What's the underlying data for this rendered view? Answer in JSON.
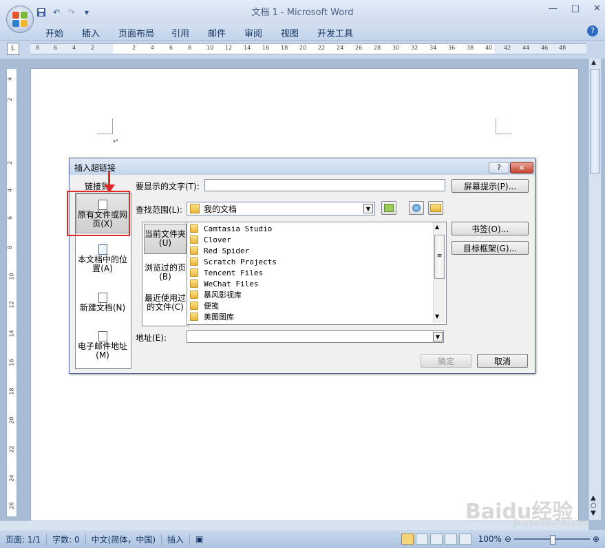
{
  "window": {
    "title": "文档 1 - Microsoft Word"
  },
  "qat": {
    "save": "save-icon",
    "undo": "↶",
    "redo": "↷",
    "more": "▾"
  },
  "tabs": [
    "开始",
    "插入",
    "页面布局",
    "引用",
    "邮件",
    "审阅",
    "视图",
    "开发工具"
  ],
  "help": "?",
  "ruler": {
    "tab_selector": "L",
    "h_numbers": [
      "8",
      "6",
      "4",
      "2",
      "2",
      "4",
      "6",
      "8",
      "10",
      "12",
      "14",
      "16",
      "18",
      "20",
      "22",
      "24",
      "26",
      "28",
      "30",
      "32",
      "34",
      "36",
      "38",
      "40",
      "42",
      "44",
      "46",
      "48"
    ],
    "v_numbers": [
      "4",
      "2",
      "2",
      "4",
      "6",
      "8",
      "10",
      "12",
      "14",
      "16",
      "18",
      "20",
      "22",
      "24",
      "26"
    ]
  },
  "dialog": {
    "title": "插入超链接",
    "help_button": "?",
    "close_button": "×",
    "link_to_label": "链接到:",
    "display_text_label": "要显示的文字(T):",
    "display_text_value": "",
    "screentip_button": "屏幕提示(P)...",
    "lookin_label": "查找范围(L):",
    "lookin_value": "我的文档",
    "link_items": [
      "原有文件或网页(X)",
      "本文档中的位置(A)",
      "新建文档(N)",
      "电子邮件地址(M)"
    ],
    "side_tabs": [
      "当前文件夹(U)",
      "浏览过的页(B)",
      "最近使用过的文件(C)"
    ],
    "files": [
      "Camtasia Studio",
      "Clover",
      "Red Spider",
      "Scratch Projects",
      "Tencent Files",
      "WeChat Files",
      "暴风影视库",
      "便笺",
      "美图图库"
    ],
    "bookmark_button": "书签(O)...",
    "target_frame_button": "目标框架(G)...",
    "address_label": "地址(E):",
    "address_value": "",
    "ok_button": "确定",
    "cancel_button": "取消"
  },
  "status": {
    "page": "页面: 1/1",
    "words": "字数: 0",
    "language": "中文(简体，中国)",
    "mode": "插入",
    "zoom": "100%"
  },
  "watermark": {
    "logo": "Baidu经验",
    "url": "jingyan.baidu.com"
  },
  "colors": {
    "accent": "#e02a2a",
    "ribbon": "#c2d3ea"
  }
}
